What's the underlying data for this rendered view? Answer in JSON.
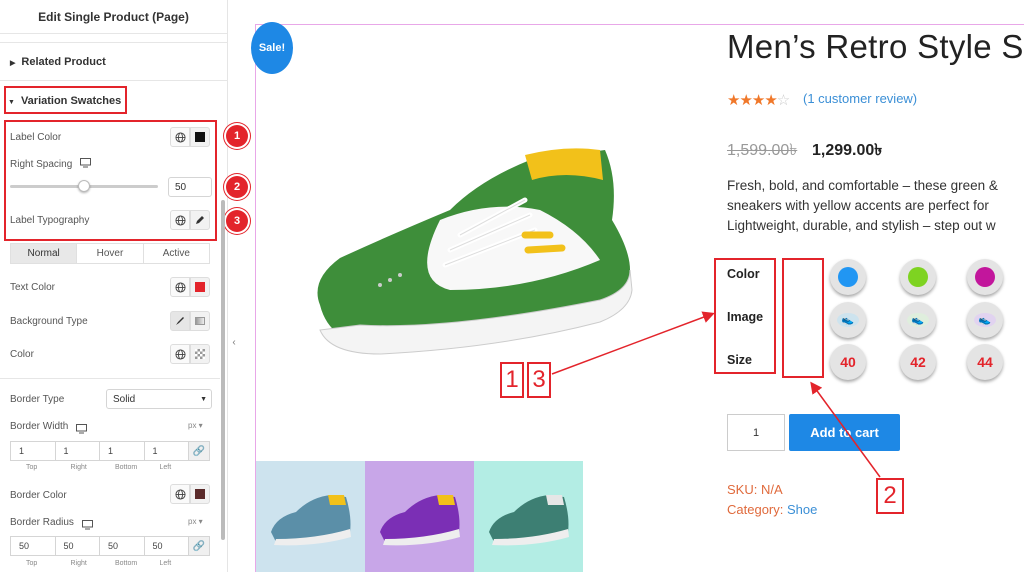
{
  "editor": {
    "title": "Edit Single Product (Page)",
    "sections": {
      "related": "Related Product",
      "variation": "Variation Swatches"
    },
    "label_color": "Label Color",
    "right_spacing": "Right Spacing",
    "right_spacing_value": "50",
    "right_spacing_fraction": 0.5,
    "label_typography": "Label Typography",
    "tabs": [
      "Normal",
      "Hover",
      "Active"
    ],
    "text_color": "Text Color",
    "background_type": "Background Type",
    "color": "Color",
    "border_type": "Border Type",
    "border_type_value": "Solid",
    "border_width": "Border Width",
    "unit": "px",
    "border_width_values": [
      "1",
      "1",
      "1",
      "1"
    ],
    "dim_labels": [
      "Top",
      "Right",
      "Bottom",
      "Left"
    ],
    "border_color": "Border Color",
    "border_radius": "Border Radius",
    "border_radius_values": [
      "50",
      "50",
      "50",
      "50"
    ],
    "callouts": [
      "1",
      "2",
      "3"
    ],
    "colors": {
      "text_color_swatch": "#e3242b",
      "label_color_swatch": "#111111",
      "border_color_swatch": "#5a2a2a"
    }
  },
  "product": {
    "sale_badge": "Sale!",
    "title": "Men’s Retro Style S",
    "rating_stars": 4,
    "review_link": "(1 customer review)",
    "old_price": "1,599.00৳",
    "new_price": "1,299.00৳",
    "description": [
      "Fresh, bold, and comfortable – these green &",
      "sneakers with yellow accents are perfect for",
      "Lightweight, durable, and stylish – step out w"
    ],
    "variation_labels": [
      "Color",
      "Image",
      "Size"
    ],
    "color_swatches": [
      "#2196f3",
      "#7ed321",
      "#c2169c"
    ],
    "sizes": [
      "40",
      "42",
      "44"
    ],
    "quantity": "1",
    "add_to_cart": "Add to cart",
    "sku": "SKU: N/A",
    "category_label": "Category:",
    "category_value": "Shoe"
  },
  "annotations": {
    "box_1_3": [
      "1",
      "3"
    ],
    "box_2": "2"
  }
}
